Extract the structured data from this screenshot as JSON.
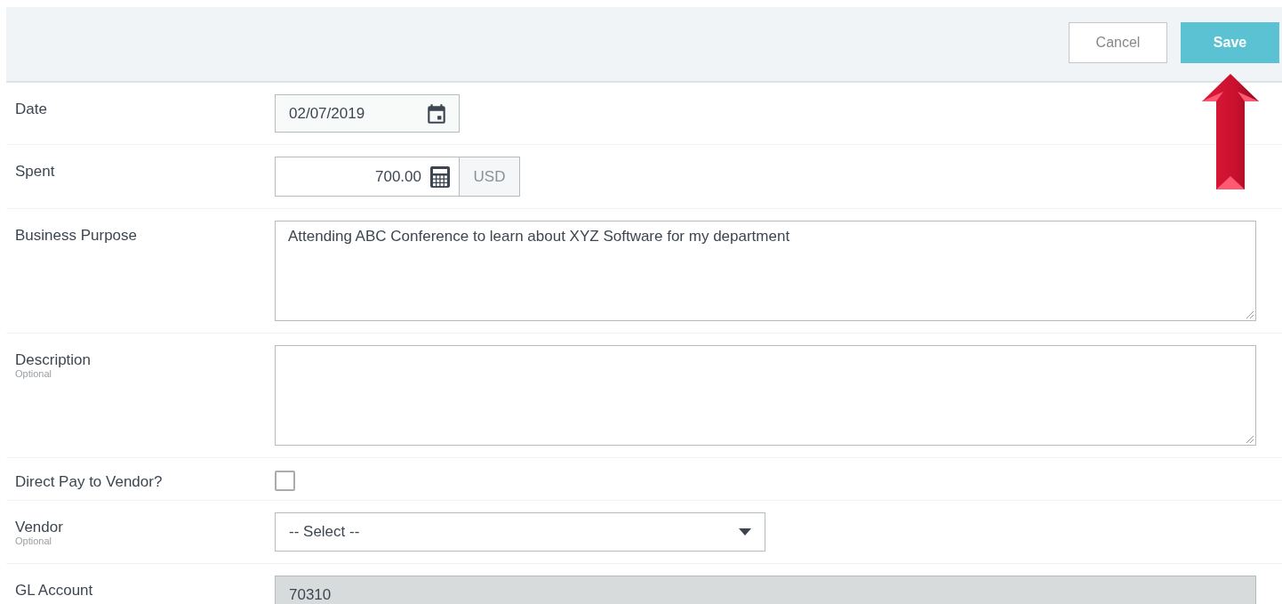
{
  "toolbar": {
    "buttons": [
      {
        "label": "Cancel",
        "kind": "secondary"
      },
      {
        "label": "Save",
        "kind": "primary"
      }
    ]
  },
  "fields": [
    {
      "label": "Date",
      "kind": "date",
      "value": "02/07/2019"
    },
    {
      "label": "Spent",
      "kind": "amount",
      "value": "700.00",
      "currency": "USD"
    },
    {
      "label": "Business Purpose",
      "kind": "textarea",
      "value": "Attending ABC Conference to learn about XYZ Software for my department"
    },
    {
      "label": "Description",
      "hint": "Optional",
      "kind": "textarea"
    },
    {
      "label": "Direct Pay to Vendor?",
      "kind": "checkbox",
      "checked": false
    },
    {
      "label": "Vendor",
      "hint": "Optional",
      "kind": "select",
      "value": "-- Select --"
    },
    {
      "label": "GL Account",
      "kind": "readonly",
      "value": "70310",
      "disabled": true
    }
  ]
}
